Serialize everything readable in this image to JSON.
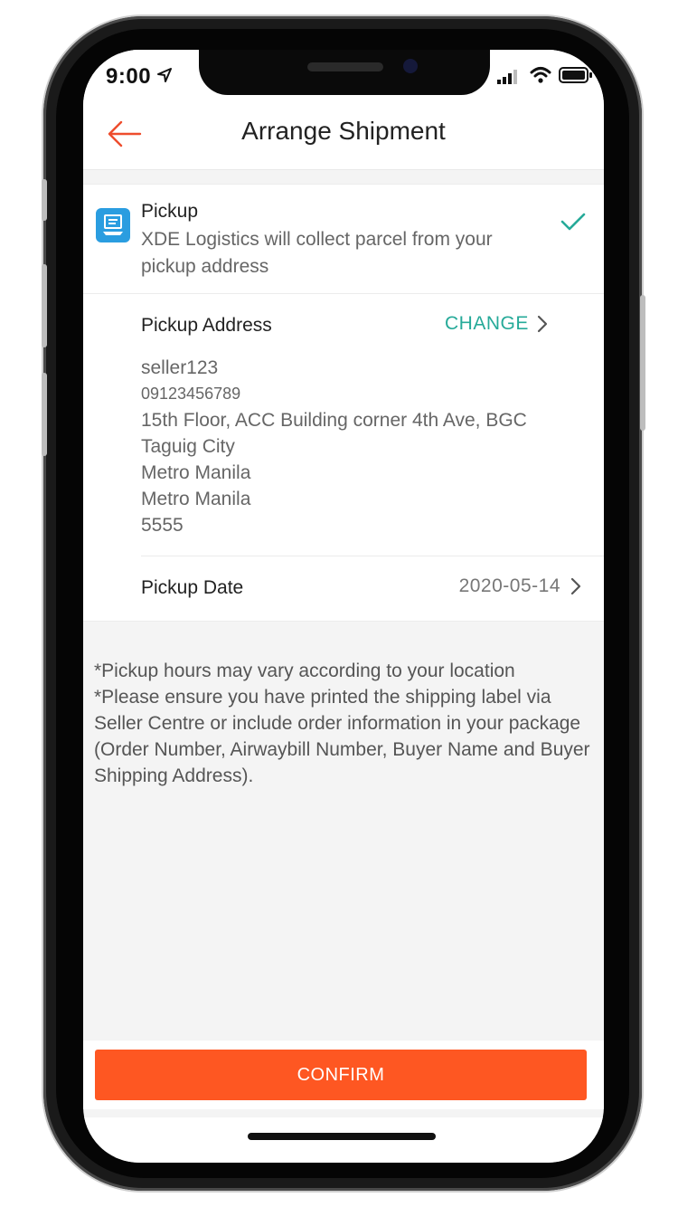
{
  "status_bar": {
    "time": "9:00",
    "location_icon": "location-arrow-icon",
    "signal_icon": "signal-icon",
    "wifi_icon": "wifi-icon",
    "battery_icon": "battery-icon"
  },
  "header": {
    "title": "Arrange Shipment",
    "back_icon": "back-arrow-icon"
  },
  "pickup": {
    "title": "Pickup",
    "description": "XDE Logistics will collect parcel from your pickup address",
    "icon": "pickup-truck-icon",
    "selected_icon": "check-icon"
  },
  "address": {
    "label": "Pickup Address",
    "change_label": "CHANGE",
    "lines": [
      "seller123",
      "09123456789",
      "15th Floor, ACC Building corner 4th Ave, BGC",
      "Taguig City",
      "Metro Manila",
      "Metro Manila",
      "5555"
    ]
  },
  "date": {
    "label": "Pickup Date",
    "value": "2020-05-14"
  },
  "notes": {
    "line1": "*Pickup hours may vary according to your location",
    "line2": "*Please ensure you have printed the shipping label via Seller Centre or include order information in your package (Order Number, Airwaybill Number, Buyer Name and Buyer Shipping Address)."
  },
  "footer": {
    "confirm_label": "CONFIRM"
  },
  "colors": {
    "accent": "#fe5722",
    "teal": "#26aa99",
    "icon_blue": "#2a9de0"
  }
}
